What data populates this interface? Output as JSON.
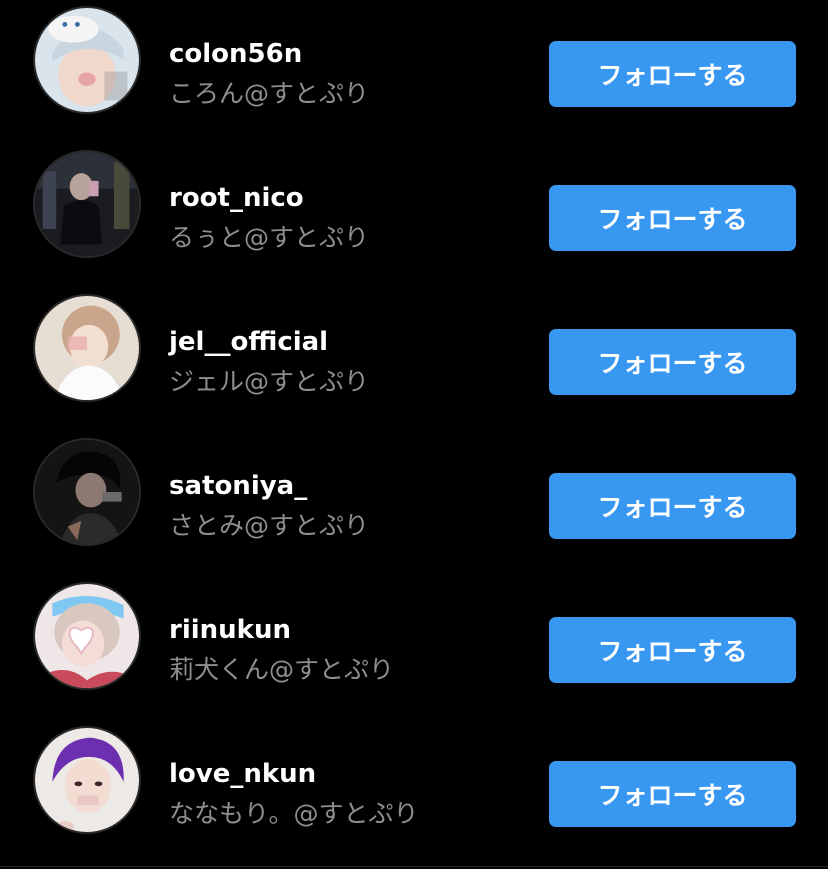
{
  "colors": {
    "background": "#000000",
    "username": "#ffffff",
    "subtext": "#8e8e8e",
    "follow_button": "#3897f0"
  },
  "follow_list": [
    {
      "username": "colon56n",
      "display_name": "ころん@すとぷり",
      "button_label": "フォローする",
      "avatar_icon": "profile-photo"
    },
    {
      "username": "root_nico",
      "display_name": "るぅと@すとぷり",
      "button_label": "フォローする",
      "avatar_icon": "profile-photo"
    },
    {
      "username": "jel__official",
      "display_name": "ジェル@すとぷり",
      "button_label": "フォローする",
      "avatar_icon": "profile-photo"
    },
    {
      "username": "satoniya_",
      "display_name": "さとみ@すとぷり",
      "button_label": "フォローする",
      "avatar_icon": "profile-photo"
    },
    {
      "username": "riinukun",
      "display_name": "莉犬くん@すとぷり",
      "button_label": "フォローする",
      "avatar_icon": "profile-photo"
    },
    {
      "username": "love_nkun",
      "display_name": "ななもり。@すとぷり",
      "button_label": "フォローする",
      "avatar_icon": "profile-photo"
    }
  ]
}
